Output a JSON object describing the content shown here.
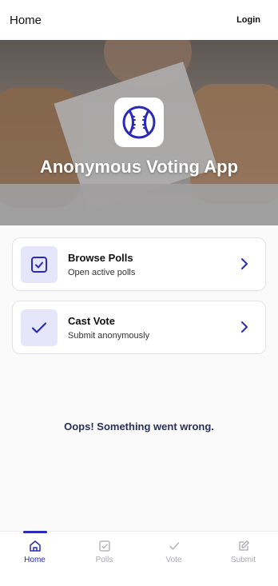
{
  "header": {
    "title": "Home",
    "login_label": "Login"
  },
  "hero": {
    "title": "Anonymous Voting App"
  },
  "cards": [
    {
      "label": "Browse Polls",
      "description": "Open active polls"
    },
    {
      "label": "Cast Vote",
      "description": "Submit anonymously"
    }
  ],
  "error": {
    "message": "Oops! Something went wrong."
  },
  "nav": {
    "tabs": [
      {
        "label": "Home",
        "active": true
      },
      {
        "label": "Polls",
        "active": false
      },
      {
        "label": "Vote",
        "active": false
      },
      {
        "label": "Submit",
        "active": false
      }
    ]
  },
  "colors": {
    "accent": "#2a2ab8",
    "tile_bg": "#e6e6fb",
    "inactive": "#a8a8b0",
    "error_text": "#2a2f5a"
  },
  "icons": {
    "app": "baseball-icon",
    "browse": "checkbox-icon",
    "vote": "check-icon",
    "chevron": "chevron-right-icon",
    "nav": [
      "home-icon",
      "checkbox-icon",
      "check-icon",
      "edit-icon"
    ]
  }
}
